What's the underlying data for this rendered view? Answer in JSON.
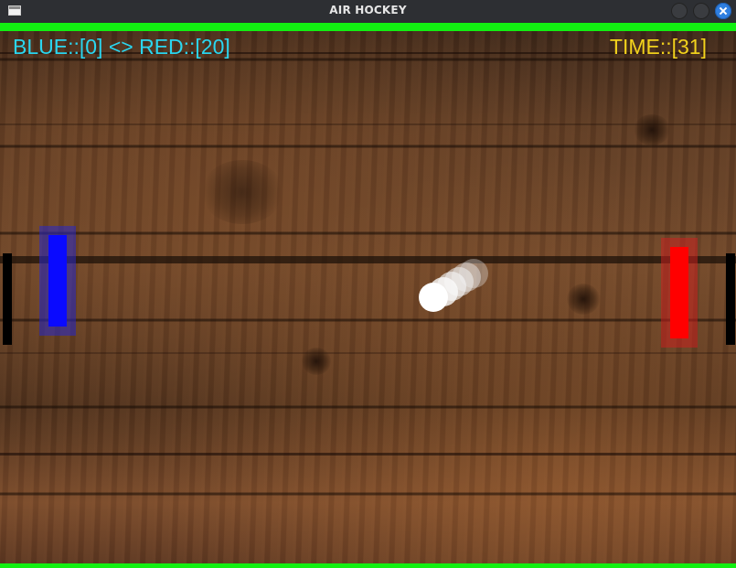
{
  "window": {
    "title": "AIR HOCKEY"
  },
  "hud": {
    "score_text": "BLUE::[0] <> RED::[20]",
    "timer_text": "TIME::[31]",
    "score_color": "#2ad6f0",
    "timer_color": "#f2d21c"
  },
  "game": {
    "blue_score": 0,
    "red_score": 20,
    "time_remaining": 31,
    "colors": {
      "border": "#12f012",
      "blue_paddle": "#0a0aff",
      "red_paddle": "#ff0000",
      "puck": "#ffffff",
      "goal": "#000000"
    }
  },
  "icons": {
    "app": "window-icon",
    "minimize": "circle-button",
    "maximize": "circle-button",
    "close": "close-x"
  }
}
